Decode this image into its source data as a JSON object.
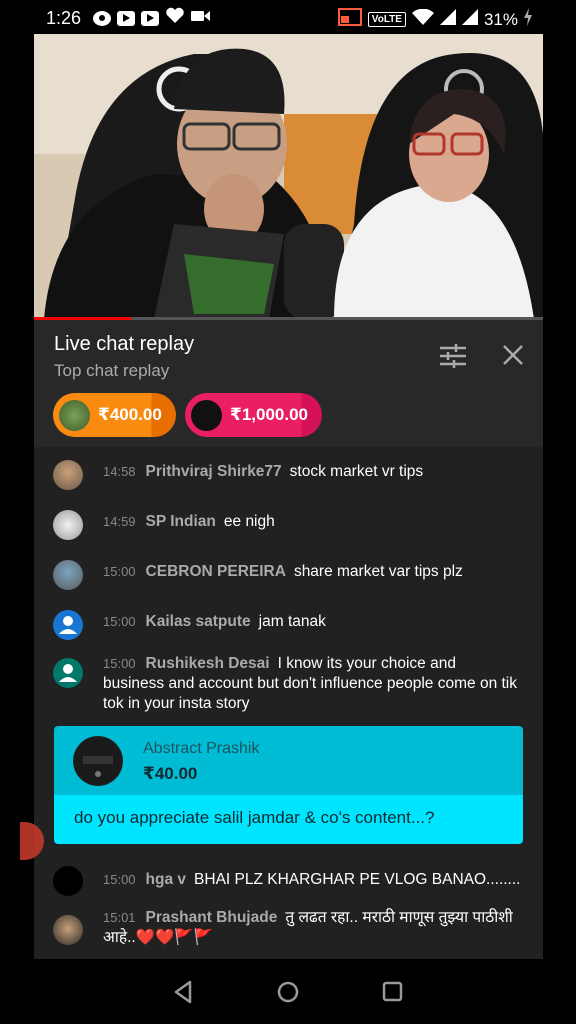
{
  "status_bar": {
    "time": "1:26",
    "volte": "VoLTE",
    "battery": "31%",
    "left_icons": [
      "whatsapp-icon",
      "youtube-icon",
      "youtube-icon",
      "health-heart-icon",
      "video-camera-icon"
    ],
    "right_icons": [
      "cast-icon",
      "wifi-icon",
      "signal-icon",
      "signal-icon",
      "battery-charging-icon"
    ]
  },
  "video": {
    "progress_fraction": 0.19
  },
  "chat_panel": {
    "title": "Live chat replay",
    "subtitle": "Top chat replay",
    "tickers": [
      {
        "amount": "₹400.00",
        "color": "#f98c10"
      },
      {
        "amount": "₹1,000.00",
        "color": "#e91e63"
      }
    ],
    "messages": [
      {
        "time": "14:58",
        "author": "Prithviraj Shirke77",
        "text": "stock market vr tips"
      },
      {
        "time": "14:59",
        "author": "SP Indian",
        "text": "ee nigh"
      },
      {
        "time": "15:00",
        "author": "CEBRON PEREIRA",
        "text": "share market var tips plz"
      },
      {
        "time": "15:00",
        "author": "Kailas satpute",
        "text": "jam tanak"
      },
      {
        "time": "15:00",
        "author": "Rushikesh Desai",
        "text": "I know its your choice and business and account but don't influence people come on tik tok in your insta story"
      }
    ],
    "superchat": {
      "author": "Abstract Prashik",
      "amount": "₹40.00",
      "message": "do you appreciate salil jamdar & co's content...?",
      "top_color": "#00bcd4",
      "bottom_color": "#00e5ff"
    },
    "messages_after": [
      {
        "time": "15:00",
        "author": "hga v",
        "text": "BHAI PLZ KHARGHAR PE VLOG BANAO........"
      },
      {
        "time": "15:01",
        "author": "Prashant Bhujade",
        "text": "तु लढत रहा.. मराठी माणूस तुझ्या पाठीशी आहे..❤️❤️🚩🚩"
      }
    ]
  },
  "nav_bar": {
    "buttons": [
      "back-icon",
      "home-icon",
      "recents-icon"
    ]
  }
}
